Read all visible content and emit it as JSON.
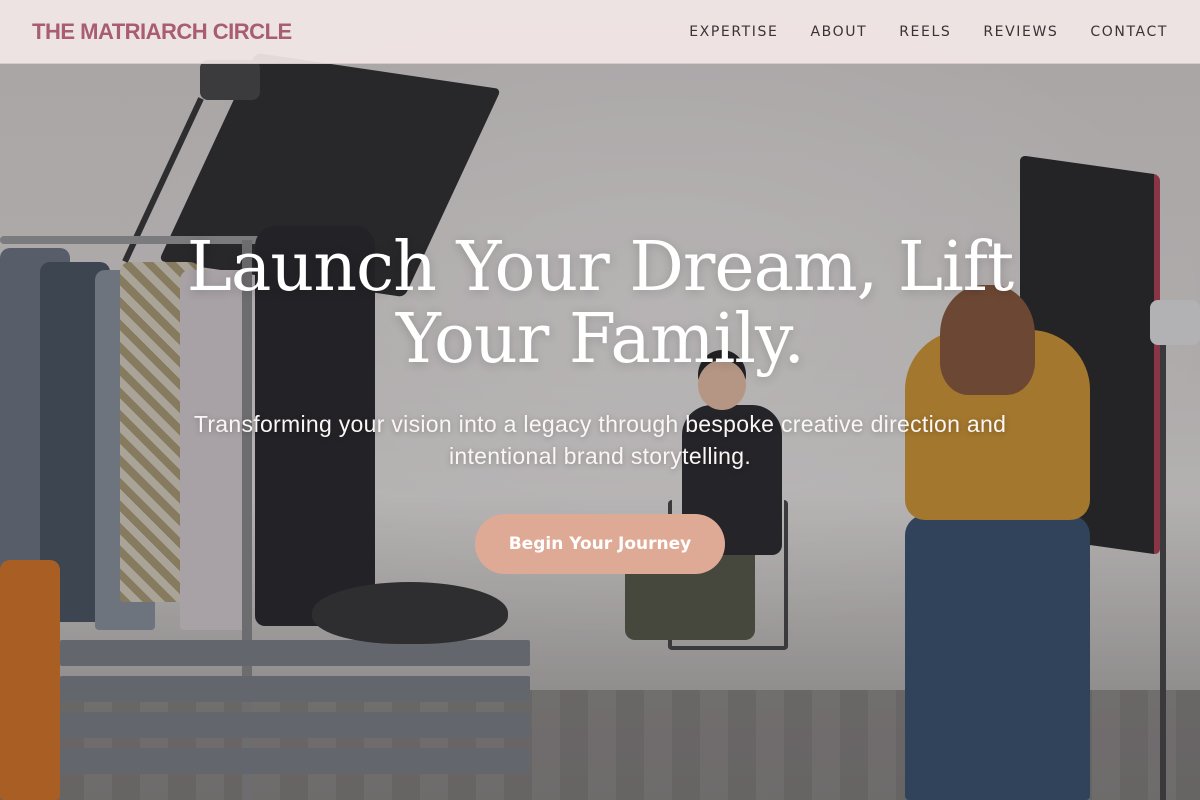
{
  "navbar": {
    "brand": "THE MATRIARCH CIRCLE",
    "links": [
      "EXPERTISE",
      "ABOUT",
      "REELS",
      "REVIEWS",
      "CONTACT"
    ]
  },
  "hero": {
    "headline": "Launch Your Dream, Lift Your Family.",
    "subheadline": "Transforming your vision into a legacy through bespoke creative direction and intentional brand storytelling.",
    "cta_label": "Begin Your Journey"
  },
  "colors": {
    "brand": "#a85d72",
    "navbar_bg": "#f3e8e7",
    "cta_bg": "#dfaa95",
    "text_light": "#ffffff"
  }
}
